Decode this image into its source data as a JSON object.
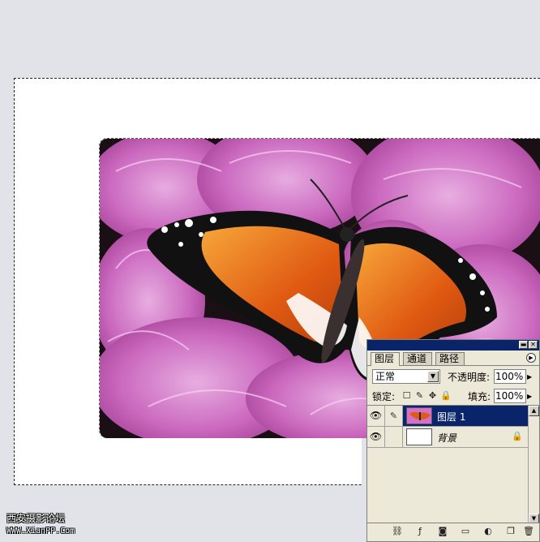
{
  "watermark": {
    "line1": "西安摄影论坛",
    "line2": "WWW.XianPP.Com"
  },
  "layers_palette": {
    "tabs": [
      {
        "label": "图层",
        "active": true
      },
      {
        "label": "通道",
        "active": false
      },
      {
        "label": "路径",
        "active": false
      }
    ],
    "blend_mode": "正常",
    "opacity_label": "不透明度:",
    "opacity_value": "100%",
    "lock_label": "锁定:",
    "fill_label": "填充:",
    "fill_value": "100%",
    "layers": [
      {
        "name": "图层 1",
        "selected": true,
        "visible": true
      },
      {
        "name": "背景",
        "selected": false,
        "visible": true,
        "locked": true
      }
    ]
  },
  "colors": {
    "workspace": "#e1e3e8",
    "selection_blue": "#0a246a",
    "panel": "#ece9d8"
  }
}
